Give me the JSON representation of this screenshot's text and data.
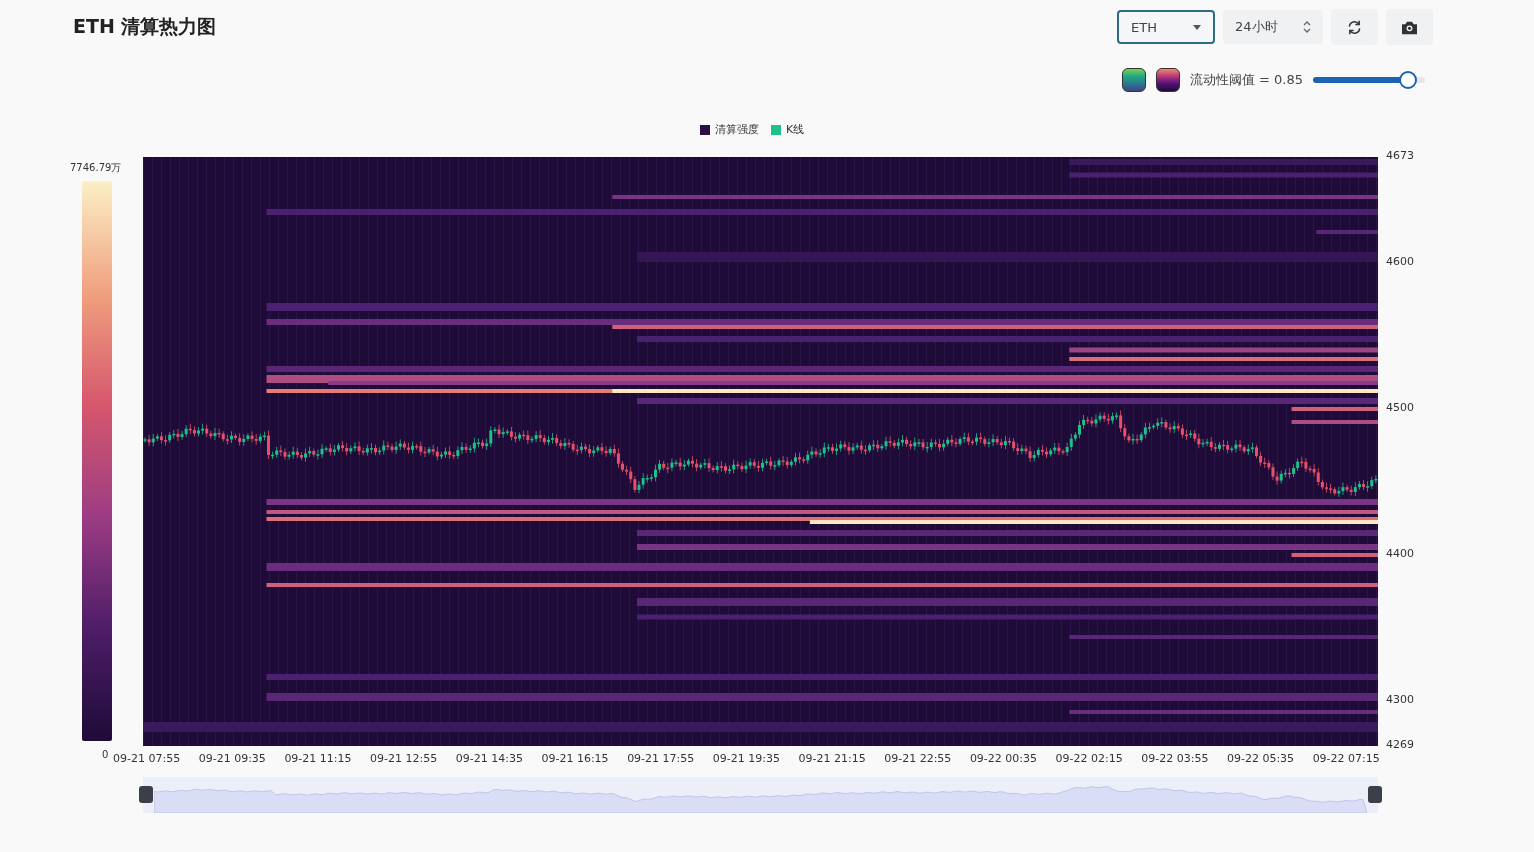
{
  "title": "ETH 清算热力图",
  "controls": {
    "symbol": {
      "value": "ETH"
    },
    "range": {
      "value": "24小时"
    }
  },
  "palettes": [
    {
      "kind": "viridis"
    },
    {
      "kind": "magma"
    }
  ],
  "zoom": {
    "level": 1
  },
  "threshold": {
    "label": "流动性阈值 = 0.85",
    "level": 0.85
  },
  "legend": [
    {
      "label": "清算强度",
      "color": "#2c0f45"
    },
    {
      "label": "K线",
      "color": "#1fc08a"
    }
  ],
  "colorbar": {
    "max": "7746.79万",
    "min": "0"
  },
  "y_ticks": [
    "4673",
    "4600",
    "4500",
    "4400",
    "4300",
    "4269"
  ],
  "x_ticks": [
    "09-21 07:55",
    "09-21 09:35",
    "09-21 11:15",
    "09-21 12:55",
    "09-21 14:35",
    "09-21 16:15",
    "09-21 17:55",
    "09-21 19:35",
    "09-21 21:15",
    "09-21 22:55",
    "09-22 00:35",
    "09-22 02:15",
    "09-22 03:55",
    "09-22 05:35",
    "09-22 07:15"
  ]
}
